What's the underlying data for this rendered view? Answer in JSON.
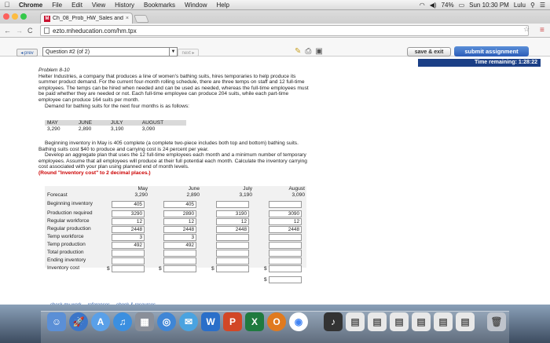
{
  "menubar": {
    "app": "Chrome",
    "items": [
      "File",
      "Edit",
      "View",
      "History",
      "Bookmarks",
      "Window",
      "Help"
    ],
    "battery": "74%",
    "clock": "Sun 10:30 PM",
    "user": "Lulu"
  },
  "browser": {
    "tab_title": "Ch_08_Prob_HW_Sales and",
    "tab_favicon": "M",
    "url": "ezto.mheducation.com/hm.tpx"
  },
  "toolbar": {
    "prev_label": "◂ prev",
    "question_select": "Question #2 (of 2)",
    "next_label": "next ▸",
    "save_label": "save & exit",
    "submit_label": "submit assignment",
    "timer": "Time remaining: 1:28:22"
  },
  "problem": {
    "title": "Problem 8-10",
    "p1": "Helter Industries, a company that produces a line of women's bathing suits, hires temporaries to help produce its summer product demand. For the current four-month rolling schedule, there are three temps on staff and 12 full-time employees. The temps can be hired when needed and can be used as needed, whereas the full-time employees must be paid whether they are needed or not. Each full-time employee can produce 204 suits, while each part-time employee can produce 164 suits per month.",
    "p2": "Demand for bathing suits for the next four months is as follows:",
    "p3": "Beginning inventory in May is 405 complete (a complete two-piece includes both top and bottom) bathing suits. Bathing suits cost $40 to produce and carrying cost is 24 percent per year.",
    "p4": "Develop an aggregate plan that uses the 12 full-time employees each month and a minimum number of temporary employees. Assume that all employees will produce at their full potential each month. Calculate the inventory carrying cost associated with your plan using planned end of month levels.",
    "p5": "(Round \"Inventory cost\" to 2 decimal places.)"
  },
  "demand": {
    "headers": [
      "MAY",
      "JUNE",
      "JULY",
      "AUGUST"
    ],
    "values": [
      "3,290",
      "2,890",
      "3,190",
      "3,090"
    ]
  },
  "plan": {
    "months": [
      "May",
      "June",
      "July",
      "August"
    ],
    "forecast_label": "Forecast",
    "forecast": [
      "3,290",
      "2,890",
      "3,190",
      "3,090"
    ],
    "row_labels": [
      "Beginning inventory",
      "Production required",
      "Regular workforce",
      "Regular production",
      "Temp workforce",
      "Temp production",
      "Total production",
      "Ending inventory",
      "Inventory cost"
    ],
    "beginning_inventory": [
      "405",
      "405",
      "",
      ""
    ],
    "production_required": [
      "3290",
      "2890",
      "3190",
      "3090"
    ],
    "regular_workforce": [
      "12",
      "12",
      "12",
      "12"
    ],
    "regular_production": [
      "2448",
      "2448",
      "2448",
      "2448"
    ],
    "temp_workforce": [
      "3",
      "3",
      "",
      ""
    ],
    "temp_production": [
      "492",
      "492",
      "",
      ""
    ],
    "dollar": "$"
  },
  "links": [
    "check my work",
    "references",
    "ebook & resources"
  ]
}
